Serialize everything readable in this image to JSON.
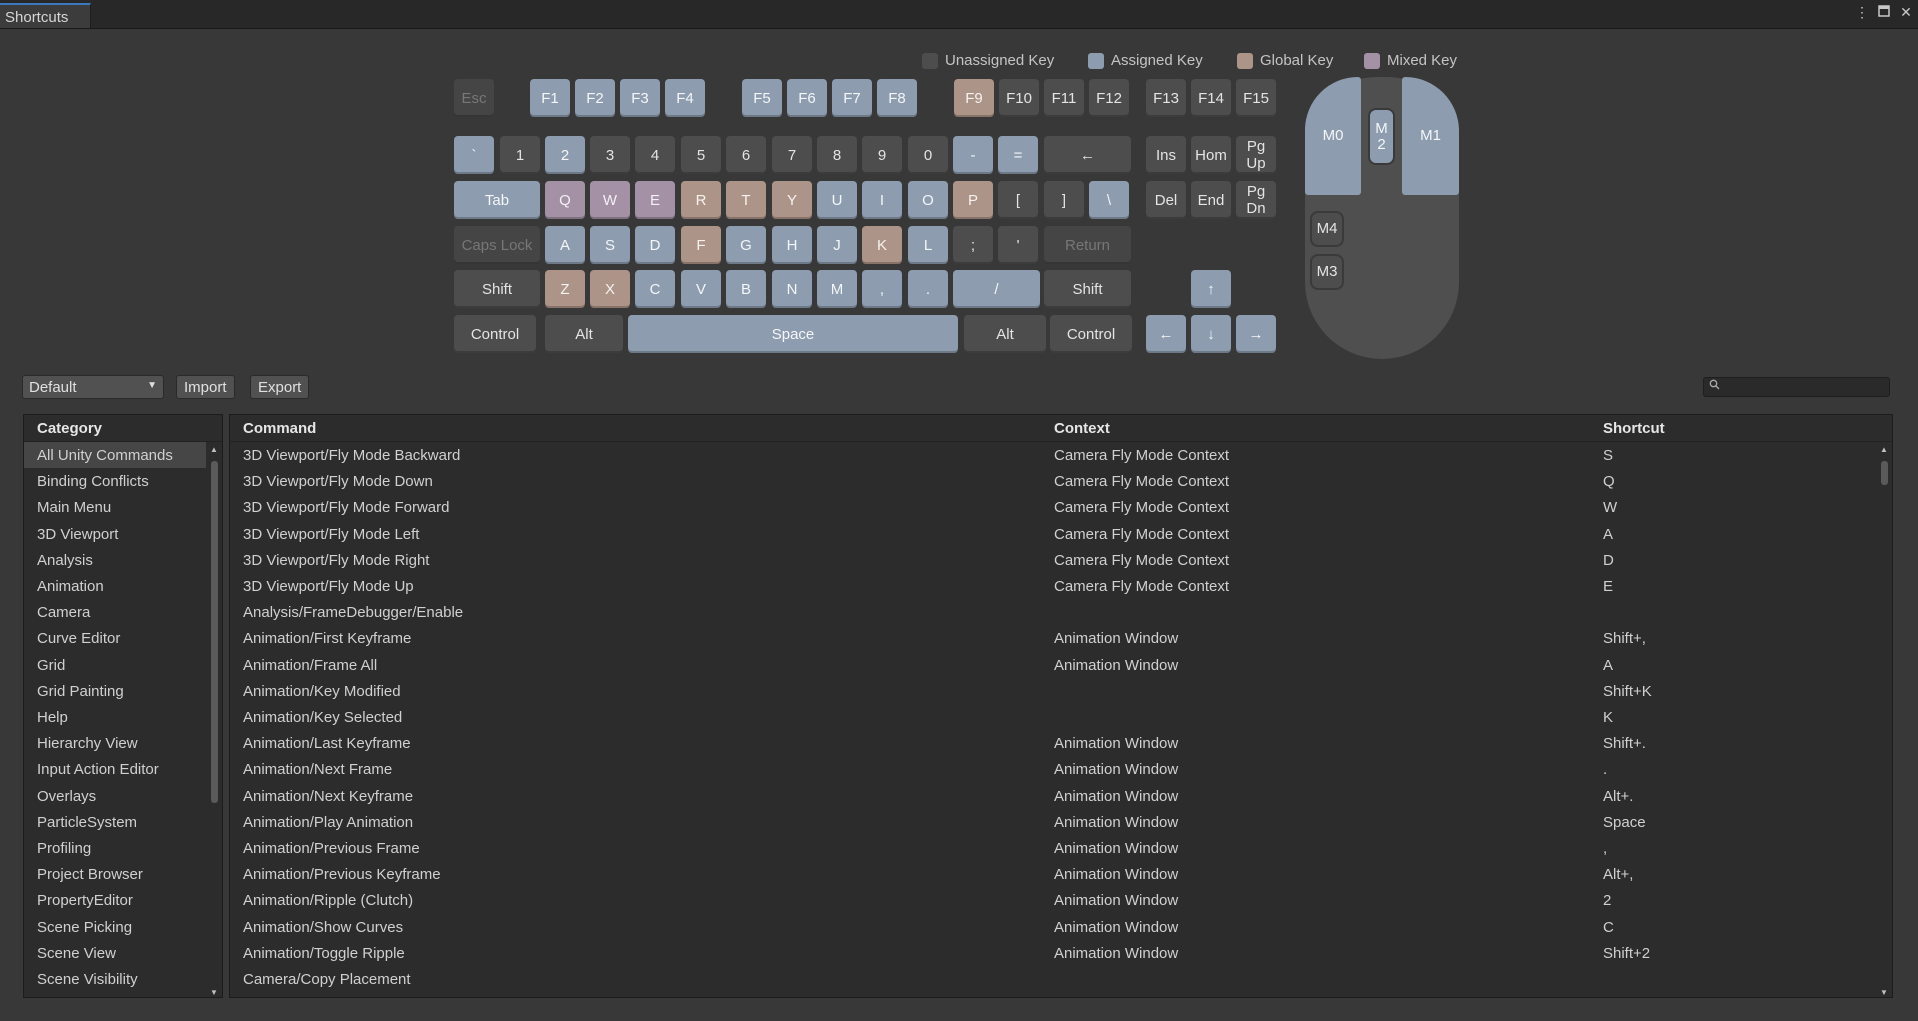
{
  "window": {
    "tab": "Shortcuts",
    "menu_icon": "⋮",
    "maximize_icon": "🗖",
    "close_icon": "✕"
  },
  "legend": [
    {
      "label": "Unassigned Key",
      "color": "#4d4d4d"
    },
    {
      "label": "Assigned Key",
      "color": "#8d9caf"
    },
    {
      "label": "Global Key",
      "color": "#ad9488"
    },
    {
      "label": "Mixed Key",
      "color": "#a491a6"
    }
  ],
  "keyboard": {
    "function_row": [
      "Esc",
      "F1",
      "F2",
      "F3",
      "F4",
      "F5",
      "F6",
      "F7",
      "F8",
      "F9",
      "F10",
      "F11",
      "F12",
      "F13",
      "F14",
      "F15"
    ],
    "number_row": [
      "`",
      "1",
      "2",
      "3",
      "4",
      "5",
      "6",
      "7",
      "8",
      "9",
      "0",
      "-",
      "=",
      "←"
    ],
    "qwerty_row": [
      "Tab",
      "Q",
      "W",
      "E",
      "R",
      "T",
      "Y",
      "U",
      "I",
      "O",
      "P",
      "[",
      "]",
      "\\"
    ],
    "asdf_row": [
      "Caps Lock",
      "A",
      "S",
      "D",
      "F",
      "G",
      "H",
      "J",
      "K",
      "L",
      ";",
      "'",
      "Return"
    ],
    "zxcv_row": [
      "Shift",
      "Z",
      "X",
      "C",
      "V",
      "B",
      "N",
      "M",
      ",",
      ".",
      "/",
      "Shift"
    ],
    "bottom_row": [
      "Control",
      "Alt",
      "Space",
      "Alt",
      "Control"
    ],
    "nav": [
      "Ins",
      "Hom",
      "Pg\nUp",
      "Del",
      "End",
      "Pg\nDn"
    ],
    "arrows": [
      "↑",
      "←",
      "↓",
      "→"
    ]
  },
  "mouse": {
    "m0": "M0",
    "m1": "M1",
    "m2": "M\n2",
    "m3": "M3",
    "m4": "M4"
  },
  "toolbar": {
    "profile": "Default",
    "import": "Import",
    "export": "Export",
    "search_icon": "🔍"
  },
  "categories": {
    "header": "Category",
    "items": [
      "All Unity Commands",
      "Binding Conflicts",
      "Main Menu",
      "3D Viewport",
      "Analysis",
      "Animation",
      "Camera",
      "Curve Editor",
      "Grid",
      "Grid Painting",
      "Help",
      "Hierarchy View",
      "Input Action Editor",
      "Overlays",
      "ParticleSystem",
      "Profiling",
      "Project Browser",
      "PropertyEditor",
      "Scene Picking",
      "Scene View",
      "Scene Visibility"
    ]
  },
  "commands": {
    "headers": {
      "command": "Command",
      "context": "Context",
      "shortcut": "Shortcut"
    },
    "rows": [
      [
        "3D Viewport/Fly Mode Backward",
        "Camera Fly Mode Context",
        "S"
      ],
      [
        "3D Viewport/Fly Mode Down",
        "Camera Fly Mode Context",
        "Q"
      ],
      [
        "3D Viewport/Fly Mode Forward",
        "Camera Fly Mode Context",
        "W"
      ],
      [
        "3D Viewport/Fly Mode Left",
        "Camera Fly Mode Context",
        "A"
      ],
      [
        "3D Viewport/Fly Mode Right",
        "Camera Fly Mode Context",
        "D"
      ],
      [
        "3D Viewport/Fly Mode Up",
        "Camera Fly Mode Context",
        "E"
      ],
      [
        "Analysis/FrameDebugger/Enable",
        "",
        ""
      ],
      [
        "Animation/First Keyframe",
        "Animation Window",
        "Shift+,"
      ],
      [
        "Animation/Frame All",
        "Animation Window",
        "A"
      ],
      [
        "Animation/Key Modified",
        "",
        "Shift+K"
      ],
      [
        "Animation/Key Selected",
        "",
        "K"
      ],
      [
        "Animation/Last Keyframe",
        "Animation Window",
        "Shift+."
      ],
      [
        "Animation/Next Frame",
        "Animation Window",
        "."
      ],
      [
        "Animation/Next Keyframe",
        "Animation Window",
        "Alt+."
      ],
      [
        "Animation/Play Animation",
        "Animation Window",
        "Space"
      ],
      [
        "Animation/Previous Frame",
        "Animation Window",
        ","
      ],
      [
        "Animation/Previous Keyframe",
        "Animation Window",
        "Alt+,"
      ],
      [
        "Animation/Ripple (Clutch)",
        "Animation Window",
        "2"
      ],
      [
        "Animation/Show Curves",
        "Animation Window",
        "C"
      ],
      [
        "Animation/Toggle Ripple",
        "Animation Window",
        "Shift+2"
      ],
      [
        "Camera/Copy Placement",
        "",
        ""
      ]
    ]
  }
}
